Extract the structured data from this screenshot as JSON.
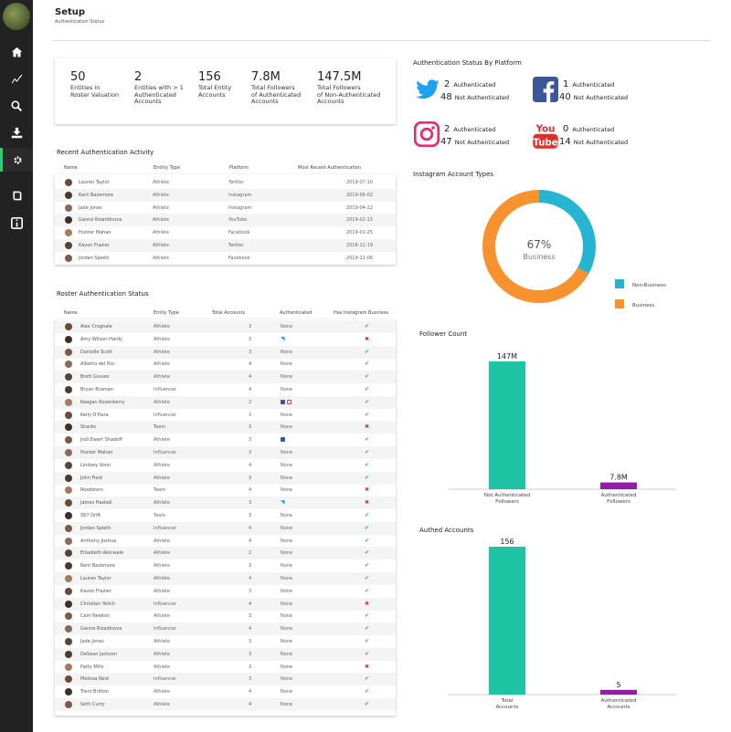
{
  "page": {
    "title": "Setup",
    "subtitle": "Authentication Status"
  },
  "nav": [
    "home",
    "chart",
    "search",
    "download",
    "settings",
    "book",
    "info"
  ],
  "stats": [
    {
      "n": "50",
      "l": "Entities in\nRoster Valuation"
    },
    {
      "n": "2",
      "l": "Entities with > 1\nAuthenticated\nAccounts"
    },
    {
      "n": "156",
      "l": "Total Entity\nAccounts"
    },
    {
      "n": "7.8M",
      "l": "Total Followers\nof Authenticated\nAccounts"
    },
    {
      "n": "147.5M",
      "l": "Total Followers\nof Non-Authenticated\nAccounts"
    }
  ],
  "recent": {
    "title": "Recent Authentication Activity",
    "headers": [
      "Name",
      "Entitiy Type",
      "Platform",
      "Most Recent Authentication"
    ],
    "rows": [
      [
        "Lauren Taylor",
        "Athlete",
        "Twitter",
        "2019-07-10"
      ],
      [
        "Kent Bazemore",
        "Athlete",
        "Instagram",
        "2019-06-02"
      ],
      [
        "Jade Jones",
        "Athlete",
        "Instagram",
        "2019-04-22"
      ],
      [
        "Ganna Rizatdinova",
        "Athlete",
        "YouTube",
        "2019-02-15"
      ],
      [
        "Hunter Mahan",
        "Athlete",
        "Facebook",
        "2019-01-25"
      ],
      [
        "Kavon Frazier",
        "Athlete",
        "Twitter",
        "2018-12-19"
      ],
      [
        "Jordan Spieth",
        "Athlete",
        "Facebook",
        "2019-11-06"
      ]
    ]
  },
  "roster": {
    "title": "Roster Authentication Status",
    "headers": [
      "Name",
      "Entity Type",
      "Total Accounts",
      "Authenticated",
      "Has Instagram Busniess"
    ],
    "rows": [
      [
        "Alex Crognale",
        "Athlete",
        "3",
        "None",
        "y"
      ],
      [
        "Amy Wilson-Hardy",
        "Athlete",
        "3",
        "tw",
        "n"
      ],
      [
        "Danielle Scott",
        "Athlete",
        "3",
        "None",
        "y"
      ],
      [
        "Alberto del Rio",
        "Athlete",
        "4",
        "None",
        "y"
      ],
      [
        "Brett Graves",
        "Athlete",
        "4",
        "None",
        "y"
      ],
      [
        "Bryan Braman",
        "Influencer",
        "4",
        "None",
        "y"
      ],
      [
        "Keegan Rosenberry",
        "Athlete",
        "2",
        "fbig",
        "y"
      ],
      [
        "Kelly O'Hara",
        "Influencer",
        "3",
        "None",
        "y"
      ],
      [
        "Sharks",
        "Team",
        "3",
        "None",
        "n"
      ],
      [
        "Jodi Ewart Shadoff",
        "Athlete",
        "3",
        "fb",
        "y"
      ],
      [
        "Hunter Mahan",
        "Influencer",
        "3",
        "None",
        "y"
      ],
      [
        "Lindsey Vonn",
        "Athlete",
        "4",
        "None",
        "y"
      ],
      [
        "John Field",
        "Athlete",
        "3",
        "None",
        "y"
      ],
      [
        "Roadsters",
        "Team",
        "4",
        "None",
        "n"
      ],
      [
        "James Haskell",
        "Athlete",
        "3",
        "tw",
        "n"
      ],
      [
        "S67 Drift",
        "Team",
        "3",
        "None",
        "y"
      ],
      [
        "Jordan Spieth",
        "Influencer",
        "4",
        "None",
        "y"
      ],
      [
        "Anthony Joshua",
        "Athlete",
        "4",
        "None",
        "y"
      ],
      [
        "Elisabeth Akinwale",
        "Athlete",
        "2",
        "None",
        "y"
      ],
      [
        "Kent Bazemore",
        "Athlete",
        "3",
        "None",
        "y"
      ],
      [
        "Lauren Taylor",
        "Athlete",
        "4",
        "None",
        "y"
      ],
      [
        "Kavon Frazier",
        "Athlete",
        "3",
        "None",
        "y"
      ],
      [
        "Christian Yelich",
        "Influencer",
        "4",
        "None",
        "n"
      ],
      [
        "Cam Newton",
        "Athlete",
        "3",
        "None",
        "y"
      ],
      [
        "Ganna Rizadinova",
        "Influencer",
        "4",
        "None",
        "y"
      ],
      [
        "Jade Jones",
        "Athlete",
        "3",
        "None",
        "y"
      ],
      [
        "DeSean Jackson",
        "Athlete",
        "3",
        "None",
        "y"
      ],
      [
        "Patty Mills",
        "Athlete",
        "3",
        "None",
        "n"
      ],
      [
        "Melissa Reid",
        "Influencer",
        "3",
        "None",
        "y"
      ],
      [
        "Trent Britton",
        "Athlete",
        "4",
        "None",
        "y"
      ],
      [
        "Seth Curry",
        "Athlete",
        "4",
        "None",
        "y"
      ]
    ]
  },
  "platforms": {
    "title": "Authentication Status By Platform",
    "items": [
      {
        "key": "twitter",
        "auth": "2",
        "not": "48",
        "auth_label": "Authenticated",
        "not_label": "Not Authenticated",
        "color": "#1da1f2"
      },
      {
        "key": "facebook",
        "auth": "1",
        "not": "40",
        "auth_label": "Authenticated",
        "not_label": "Not Authenticated",
        "color": "#3b5998"
      },
      {
        "key": "instagram",
        "auth": "2",
        "not": "47",
        "auth_label": "Authenticated",
        "not_label": "Not Authenticated",
        "color": "#e1306c"
      },
      {
        "key": "youtube",
        "auth": "0",
        "not": "14",
        "auth_label": "Authenticated",
        "not_label": "Not Authenticated",
        "color": "#e52d27"
      }
    ]
  },
  "chart_data": [
    {
      "type": "pie",
      "title": "Instagram Account Types",
      "center_value": "67%",
      "center_label": "Business",
      "labels": [
        "Non-Business",
        "Business"
      ],
      "values": [
        33,
        67
      ],
      "colors": [
        "#26b5d1",
        "#f7922f"
      ],
      "legend": "right"
    },
    {
      "type": "bar",
      "title": "Follower Count",
      "categories": [
        "Not Authenticated Followers",
        "Authenticated Followers"
      ],
      "values": [
        147,
        7.8
      ],
      "data_labels": [
        "147M",
        "7.8M"
      ],
      "colors": [
        "#1ec3a4",
        "#8e1fa6"
      ],
      "ylim": [
        0,
        147
      ]
    },
    {
      "type": "bar",
      "title": "Authed Accounts",
      "categories": [
        "Total Accounts",
        "Authenticated Accounts"
      ],
      "values": [
        156,
        5
      ],
      "data_labels": [
        "156",
        "5"
      ],
      "colors": [
        "#1ec3a4",
        "#8e1fa6"
      ],
      "ylim": [
        0,
        156
      ]
    }
  ]
}
